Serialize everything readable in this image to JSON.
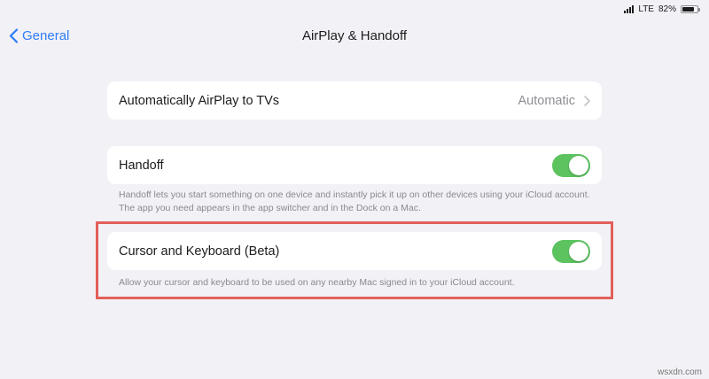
{
  "status_bar": {
    "carrier": "LTE",
    "battery_percent": "82%",
    "battery_level": 0.82
  },
  "nav": {
    "back_label": "General",
    "title": "AirPlay & Handoff"
  },
  "airplay_row": {
    "label": "Automatically AirPlay to TVs",
    "value": "Automatic"
  },
  "handoff": {
    "label": "Handoff",
    "enabled": true,
    "footer": "Handoff lets you start something on one device and instantly pick it up on other devices using your iCloud account. The app you need appears in the app switcher and in the Dock on a Mac."
  },
  "cursor_keyboard": {
    "label": "Cursor and Keyboard (Beta)",
    "enabled": true,
    "footer": "Allow your cursor and keyboard to be used on any nearby Mac signed in to your iCloud account."
  },
  "colors": {
    "accent": "#2f7cf6",
    "toggle_on": "#5cc35f",
    "highlight": "#e2605a",
    "background": "#f2f1f6"
  },
  "watermark": "wsxdn.com"
}
